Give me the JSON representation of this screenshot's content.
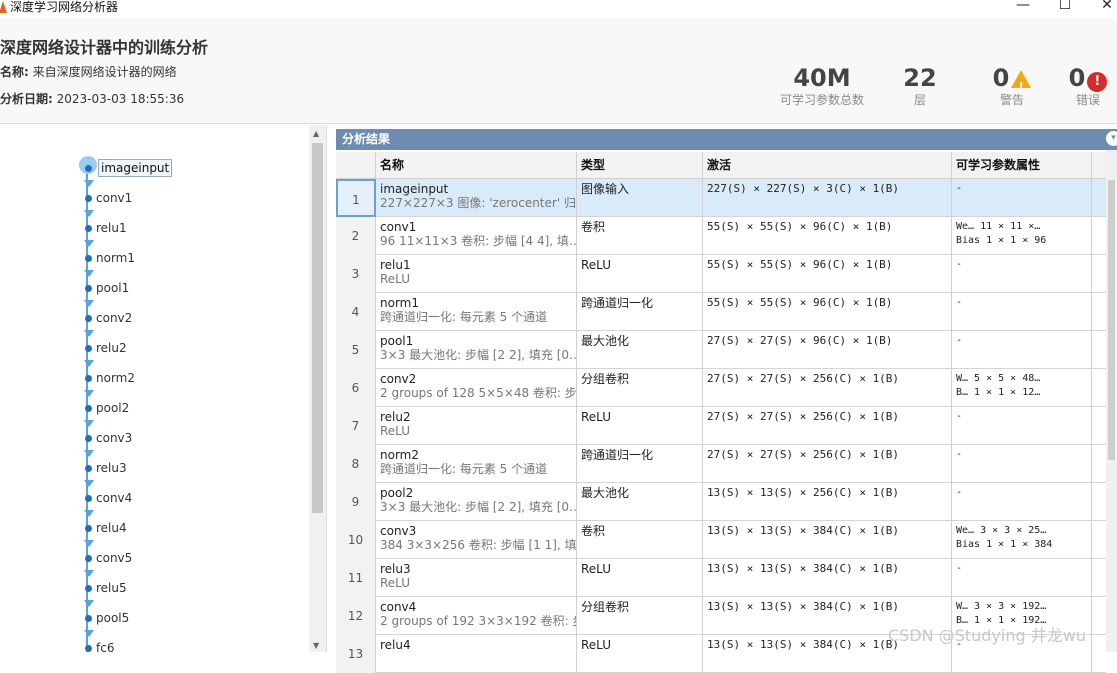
{
  "window": {
    "title": "深度学习网络分析器",
    "minimize": "—",
    "maximize": "☐",
    "close": "✕"
  },
  "header": {
    "title": "深度网络设计器中的训练分析",
    "name_key": "名称:",
    "name_value": "来自深度网络设计器的网络",
    "date_key": "分析日期:",
    "date_value": "2023-03-03 18:55:36"
  },
  "stats": [
    {
      "value": "40M",
      "label": "可学习参数总数"
    },
    {
      "value": "22",
      "label": "层"
    },
    {
      "value": "0",
      "label": "警告"
    },
    {
      "value": "0",
      "label": "错误"
    }
  ],
  "graph": {
    "nodes": [
      "imageinput",
      "conv1",
      "relu1",
      "norm1",
      "pool1",
      "conv2",
      "relu2",
      "norm2",
      "pool2",
      "conv3",
      "relu3",
      "conv4",
      "relu4",
      "conv5",
      "relu5",
      "pool5",
      "fc6"
    ]
  },
  "panel": {
    "title": "分析结果",
    "collapse_icon": "▾"
  },
  "table": {
    "headers": [
      "名称",
      "类型",
      "激活",
      "可学习参数属性"
    ],
    "rows": [
      {
        "idx": "1",
        "name": "imageinput",
        "desc": "227×227×3 图像: 'zerocenter' 归…",
        "type": "图像输入",
        "act": "227(S) × 227(S) × 3(C) × 1(B)",
        "p1": "-",
        "p2": ""
      },
      {
        "idx": "2",
        "name": "conv1",
        "desc": "96 11×11×3 卷积: 步幅 [4 4], 填…",
        "type": "卷积",
        "act": "55(S) × 55(S) × 96(C) × 1(B)",
        "p1": "We…   11 × 11 ×…",
        "p2": "Bias   1 × 1 × 96"
      },
      {
        "idx": "3",
        "name": "relu1",
        "desc": "ReLU",
        "type": "ReLU",
        "act": "55(S) × 55(S) × 96(C) × 1(B)",
        "p1": "-",
        "p2": ""
      },
      {
        "idx": "4",
        "name": "norm1",
        "desc": "跨通道归一化: 每元素 5 个通道",
        "type": "跨通道归一化",
        "act": "55(S) × 55(S) × 96(C) × 1(B)",
        "p1": "-",
        "p2": ""
      },
      {
        "idx": "5",
        "name": "pool1",
        "desc": "3×3 最大池化: 步幅 [2 2], 填充 [0…",
        "type": "最大池化",
        "act": "27(S) × 27(S) × 96(C) × 1(B)",
        "p1": "-",
        "p2": ""
      },
      {
        "idx": "6",
        "name": "conv2",
        "desc": "2 groups of 128 5×5×48 卷积: 步…",
        "type": "分组卷积",
        "act": "27(S) × 27(S) × 256(C) × 1(B)",
        "p1": "W…    5 × 5 × 48…",
        "p2": "B…    1 × 1 × 12…"
      },
      {
        "idx": "7",
        "name": "relu2",
        "desc": "ReLU",
        "type": "ReLU",
        "act": "27(S) × 27(S) × 256(C) × 1(B)",
        "p1": "-",
        "p2": ""
      },
      {
        "idx": "8",
        "name": "norm2",
        "desc": "跨通道归一化: 每元素 5 个通道",
        "type": "跨通道归一化",
        "act": "27(S) × 27(S) × 256(C) × 1(B)",
        "p1": "-",
        "p2": ""
      },
      {
        "idx": "9",
        "name": "pool2",
        "desc": "3×3 最大池化: 步幅 [2 2], 填充 [0…",
        "type": "最大池化",
        "act": "13(S) × 13(S) × 256(C) × 1(B)",
        "p1": "-",
        "p2": ""
      },
      {
        "idx": "10",
        "name": "conv3",
        "desc": "384 3×3×256 卷积: 步幅 [1 1], 填…",
        "type": "卷积",
        "act": "13(S) × 13(S) × 384(C) × 1(B)",
        "p1": "We…   3 × 3 × 25…",
        "p2": "Bias   1 × 1 × 384"
      },
      {
        "idx": "11",
        "name": "relu3",
        "desc": "ReLU",
        "type": "ReLU",
        "act": "13(S) × 13(S) × 384(C) × 1(B)",
        "p1": "-",
        "p2": ""
      },
      {
        "idx": "12",
        "name": "conv4",
        "desc": "2 groups of 192 3×3×192 卷积: 步…",
        "type": "分组卷积",
        "act": "13(S) × 13(S) × 384(C) × 1(B)",
        "p1": "W…    3 × 3 × 192…",
        "p2": "B…    1 × 1 × 192…"
      },
      {
        "idx": "13",
        "name": "relu4",
        "desc": "",
        "type": "ReLU",
        "act": "13(S) × 13(S) × 384(C) × 1(B)",
        "p1": "-",
        "p2": ""
      }
    ]
  },
  "watermark": "CSDN @Studying 井龙wu"
}
